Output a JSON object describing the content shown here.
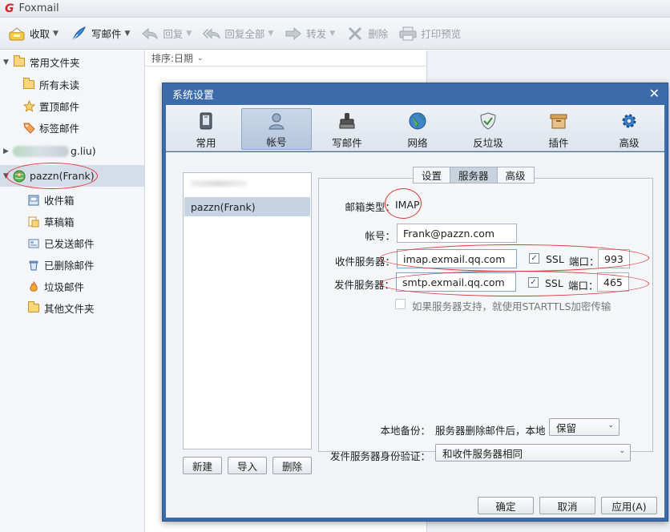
{
  "app": {
    "title": "Foxmail"
  },
  "toolbar": {
    "receive": "收取",
    "compose": "写邮件",
    "reply": "回复",
    "reply_all": "回复全部",
    "forward": "转发",
    "delete": "删除",
    "print_preview": "打印预览"
  },
  "sidebar": {
    "common_folders": "常用文件夹",
    "all_unread": "所有未读",
    "pinned": "置顶邮件",
    "tagged": "标签邮件",
    "account1_suffix": "g.liu)",
    "account2": "pazzn(Frank)",
    "inbox": "收件箱",
    "drafts": "草稿箱",
    "sent": "已发送邮件",
    "deleted": "已删除邮件",
    "junk": "垃圾邮件",
    "other": "其他文件夹"
  },
  "list": {
    "sort_label": "排序:日期"
  },
  "dialog": {
    "title": "系统设置",
    "tabs": [
      "常用",
      "帐号",
      "写邮件",
      "网络",
      "反垃圾",
      "插件",
      "高级"
    ],
    "account_list": [
      "pazzn(Frank)"
    ],
    "new_btn": "新建",
    "import_btn": "导入",
    "delete_btn": "删除",
    "subtabs": [
      "设置",
      "服务器",
      "高级"
    ],
    "mail_type_label": "邮箱类型：",
    "mail_type_value": "IMAP",
    "account_label": "帐号：",
    "account_value": "Frank@pazzn.com",
    "incoming_label": "收件服务器：",
    "incoming_value": "imap.exmail.qq.com",
    "outgoing_label": "发件服务器：",
    "outgoing_value": "smtp.exmail.qq.com",
    "ssl_label": "SSL",
    "port_label": "端口：",
    "incoming_port": "993",
    "outgoing_port": "465",
    "starttls": "如果服务器支持，就使用STARTTLS加密传输",
    "local_backup_label": "本地备份：",
    "local_backup_desc": "服务器删除邮件后，本地",
    "local_backup_value": "保留",
    "smtp_auth_label": "发件服务器身份验证：",
    "smtp_auth_value": "和收件服务器相同",
    "ok": "确定",
    "cancel": "取消",
    "apply": "应用(A)"
  }
}
